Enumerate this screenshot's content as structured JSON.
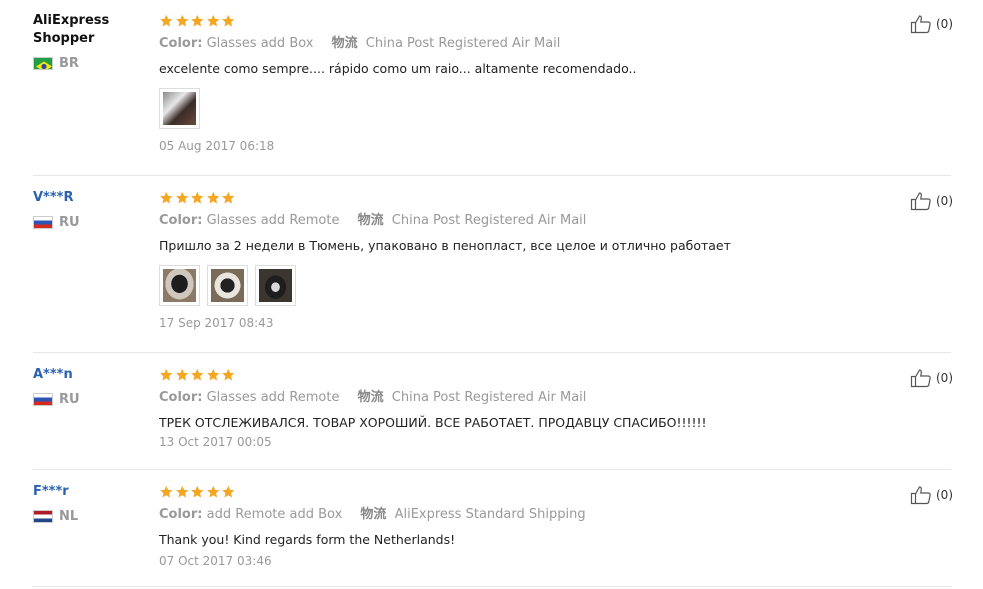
{
  "reviews": [
    {
      "user": "AliExpress Shopper",
      "user_line1": "AliExpress",
      "user_line2": "Shopper",
      "country": "BR",
      "flag": "brazil-flag-icon",
      "stars": 5,
      "color_label": "Color:",
      "color_value": "Glasses add Box",
      "ship_label": "物流",
      "ship_value": "China Post Registered Air Mail",
      "text": "excelente como sempre.... rápido como um raio... altamente recomendado..",
      "photos": 1,
      "date": "05 Aug 2017 06:18",
      "likes": "(0)"
    },
    {
      "user": "V***R",
      "country": "RU",
      "flag": "russia-flag-icon",
      "stars": 5,
      "color_label": "Color:",
      "color_value": "Glasses add Remote",
      "ship_label": "物流",
      "ship_value": "China Post Registered Air Mail",
      "text": "Пришло за 2 недели в Тюмень, упаковано в пенопласт, все целое и отлично работает",
      "photos": 3,
      "date": "17 Sep 2017 08:43",
      "likes": "(0)"
    },
    {
      "user": "A***n",
      "country": "RU",
      "flag": "russia-flag-icon",
      "stars": 5,
      "color_label": "Color:",
      "color_value": "Glasses add Remote",
      "ship_label": "物流",
      "ship_value": "China Post Registered Air Mail",
      "text": "ТРЕК ОТСЛЕЖИВАЛСЯ. ТОВАР ХОРОШИЙ. ВСЕ РАБОТАЕТ. ПРОДАВЦУ СПАСИБО!!!!!!",
      "photos": 0,
      "date": "13 Oct 2017 00:05",
      "likes": "(0)"
    },
    {
      "user": "F***r",
      "country": "NL",
      "flag": "netherlands-flag-icon",
      "stars": 5,
      "color_label": "Color:",
      "color_value": "add Remote add Box",
      "ship_label": "物流",
      "ship_value": "AliExpress Standard Shipping",
      "text": "Thank you! Kind regards form the Netherlands!",
      "photos": 0,
      "date": "07 Oct 2017 03:46",
      "likes": "(0)"
    }
  ],
  "colors": {
    "star": "#f5a623",
    "anon_user": "#2a62ae",
    "meta": "#999999",
    "divider": "#e6e6e6"
  },
  "icons": {
    "star": "star-icon",
    "like": "thumbs-up-icon"
  }
}
